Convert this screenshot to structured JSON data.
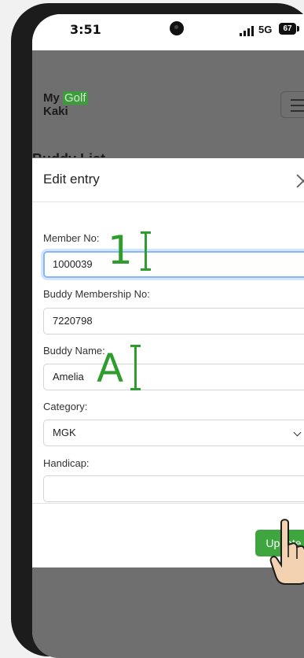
{
  "status_bar": {
    "time": "3:51",
    "network": "5G",
    "battery": "67"
  },
  "app": {
    "logo_line1": "My",
    "logo_golf": "Golf",
    "logo_line2": "Kaki",
    "behind_title": "Buddy List"
  },
  "modal": {
    "title": "Edit entry",
    "fields": {
      "member_no": {
        "label": "Member No:",
        "value": "1000039"
      },
      "buddy_membership_no": {
        "label": "Buddy Membership No:",
        "value": "7220798"
      },
      "buddy_name": {
        "label": "Buddy Name:",
        "value": "Amelia"
      },
      "category": {
        "label": "Category:",
        "value": "MGK"
      },
      "handicap": {
        "label": "Handicap:",
        "value": ""
      }
    },
    "update_label": "Update"
  },
  "annotations": {
    "numeric_cursor": "1",
    "text_cursor": "A"
  },
  "colors": {
    "accent_green": "#3fa63f",
    "focus_blue": "#86b7fe",
    "overlay": "#6f6f6f"
  },
  "icons": [
    "close-icon",
    "chevron-down-icon",
    "menu-icon",
    "signal-icon",
    "battery-icon",
    "text-cursor-icon",
    "pointer-hand-icon"
  ]
}
